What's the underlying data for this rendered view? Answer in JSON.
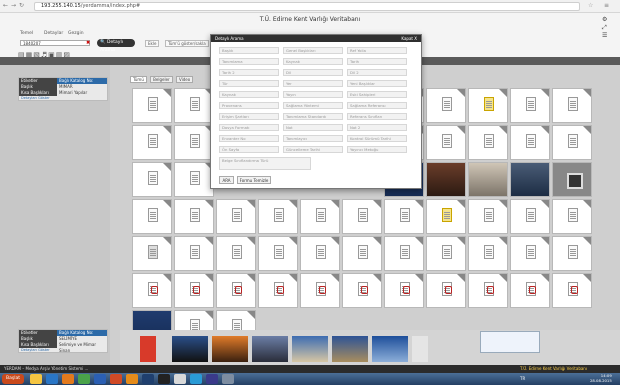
{
  "browser": {
    "url_host": "193.255.140.15",
    "url_path": "/yerdamma/index.php#"
  },
  "site": {
    "title": "T.Ü. Edirne Kent Varlığı Veritabanı"
  },
  "header": {
    "tabs": [
      "Temel",
      "Detaylar",
      "Gezgin"
    ],
    "key_input_value": "1840207",
    "advanced_search_label": "Detaylı Arama",
    "buttons": [
      "Ekle",
      "Tüm'ü göster/sakla"
    ]
  },
  "info_panels": [
    {
      "rows": [
        {
          "k": "Etiketler",
          "v": "Bağlı Katalog No:"
        },
        {
          "k": "Başlık",
          "v": "MIMAR"
        },
        {
          "k": "Kısa Başlıkları",
          "v": "Mimari Yapılar"
        }
      ],
      "link": "Detayları Göster"
    },
    {
      "rows": [
        {
          "k": "Etiketler",
          "v": "Bağlı Katalog No:"
        },
        {
          "k": "Başlık",
          "v": "SELİMİYE"
        },
        {
          "k": "Kısa Başlıkları",
          "v": "Selimiye ve Mimar Sinan"
        }
      ],
      "link": "Detayları Göster"
    }
  ],
  "view_tabs": [
    "Tümü",
    "Belgeler",
    "Video"
  ],
  "modal": {
    "title": "Detaylı Arama",
    "close_label": "Kapat X",
    "fields": [
      "Başlık",
      "Genel Başlıkları",
      "Ref Yolla",
      "Tanımlama",
      "Kaynak",
      "Tarih",
      "Tarih 2",
      "Dil",
      "Dil 2",
      "Tür",
      "Yer",
      "Yeni Başlıklar",
      "Kaynak",
      "Yayın",
      "Eski Sahipleri",
      "Provenans",
      "Sağlama Yöntemi",
      "Sağlama Referansı",
      "Erişim Şartları",
      "Tanımlama Standardı",
      "Referans Sınıfları",
      "Dosya Formatı",
      "Not",
      "Not 2",
      "Envanter No",
      "Tanımlayıcı",
      "Kontrol Sürümü Tarihi",
      "Ön Sayfa",
      "Güncelleme Tarihi",
      "Yayıncı Metoğu"
    ],
    "extra_field": "Belge Sınıflandırma Türü",
    "search_button": "ARA",
    "clear_button": "Formu Temizle"
  },
  "grid": {
    "rows": [
      [
        "doc",
        "doc",
        "blank",
        "blank",
        "blank",
        "blank",
        "doc",
        "doc",
        "yel",
        "doc",
        "doc"
      ],
      [
        "doc",
        "doc",
        "blank",
        "blank",
        "blank",
        "blank",
        "doc",
        "doc",
        "doc",
        "doc",
        "doc"
      ],
      [
        "doc",
        "doc",
        "blank",
        "blank",
        "blank",
        "blank",
        "img",
        "img",
        "img",
        "img",
        "play"
      ],
      [
        "doc",
        "doc",
        "doc",
        "doc",
        "doc",
        "doc",
        "doc",
        "yel",
        "doc",
        "doc",
        "doc"
      ],
      [
        "grid2",
        "doc",
        "doc",
        "doc",
        "doc",
        "doc",
        "doc",
        "doc",
        "doc",
        "doc",
        "doc"
      ],
      [
        "pdf",
        "pdf",
        "pdf",
        "pdf",
        "pdf",
        "pdf",
        "pdf",
        "pdf",
        "pdf",
        "pdf",
        "pdf"
      ],
      [
        "img",
        "doc",
        "doc"
      ]
    ]
  },
  "status": {
    "left": "YERDAM – Medya Arşiv Yönetim Sistemi ...",
    "right": "T.Ü. Edirne Kent Varlığı Veritabanı"
  },
  "taskbar": {
    "start_label": "Başlat",
    "time": "14:09",
    "date": "28.08.2015",
    "tray": "TR"
  },
  "colors": {
    "accent": "#2c6aa8",
    "modal_header": "#2f2f2f",
    "bar_dark": "#5a5a5a"
  }
}
